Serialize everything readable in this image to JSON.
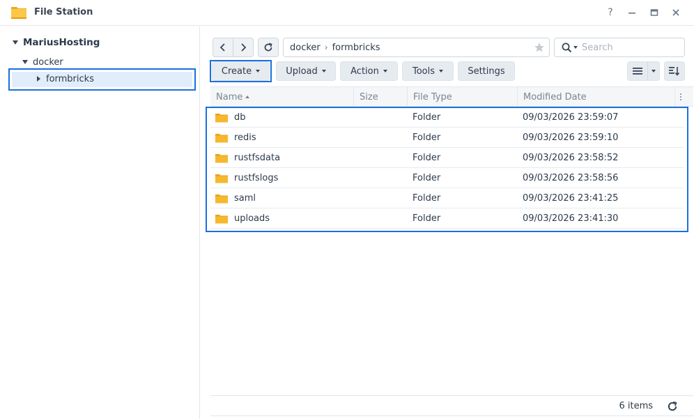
{
  "window": {
    "title": "File Station",
    "controls": [
      "help-icon",
      "minimize-icon",
      "maximize-icon",
      "close-icon"
    ]
  },
  "sidebar": {
    "root": "MariusHosting",
    "items": [
      {
        "label": "docker",
        "expanded": true
      },
      {
        "label": "formbricks",
        "selected": true
      }
    ]
  },
  "toolbar": {
    "path": [
      "docker",
      "formbricks"
    ],
    "search_placeholder": "Search",
    "buttons": {
      "create": "Create",
      "upload": "Upload",
      "action": "Action",
      "tools": "Tools",
      "settings": "Settings"
    }
  },
  "table": {
    "columns": [
      "Name",
      "Size",
      "File Type",
      "Modified Date"
    ],
    "rows": [
      {
        "name": "db",
        "size": "",
        "type": "Folder",
        "modified": "09/03/2026 23:59:07"
      },
      {
        "name": "redis",
        "size": "",
        "type": "Folder",
        "modified": "09/03/2026 23:59:10"
      },
      {
        "name": "rustfsdata",
        "size": "",
        "type": "Folder",
        "modified": "09/03/2026 23:58:52"
      },
      {
        "name": "rustfslogs",
        "size": "",
        "type": "Folder",
        "modified": "09/03/2026 23:58:56"
      },
      {
        "name": "saml",
        "size": "",
        "type": "Folder",
        "modified": "09/03/2026 23:41:25"
      },
      {
        "name": "uploads",
        "size": "",
        "type": "Folder",
        "modified": "09/03/2026 23:41:30"
      }
    ]
  },
  "footer": {
    "item_count": "6 items"
  },
  "colors": {
    "accent": "#1a6fe0",
    "folder": "#f5b82e",
    "selection": "#e2edfb"
  }
}
